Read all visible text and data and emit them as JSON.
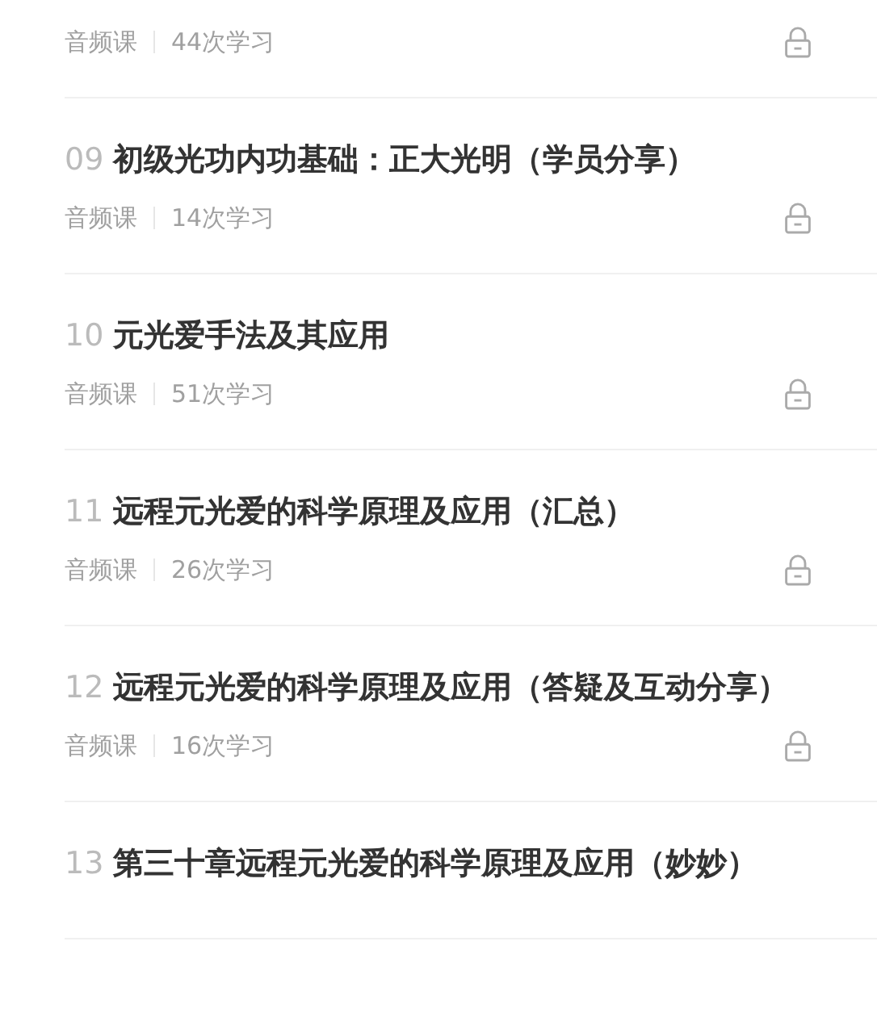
{
  "lessons": [
    {
      "type": "音频课",
      "count": "44次学习",
      "locked": true
    },
    {
      "number": "09",
      "title": "初级光功内功基础：正大光明（学员分享）",
      "type": "音频课",
      "count": "14次学习",
      "locked": true
    },
    {
      "number": "10",
      "title": "元光爱手法及其应用",
      "type": "音频课",
      "count": "51次学习",
      "locked": true
    },
    {
      "number": "11",
      "title": "远程元光爱的科学原理及应用（汇总）",
      "type": "音频课",
      "count": "26次学习",
      "locked": true
    },
    {
      "number": "12",
      "title": "远程元光爱的科学原理及应用（答疑及互动分享）",
      "type": "音频课",
      "count": "16次学习",
      "locked": true
    },
    {
      "number": "13",
      "title": "第三十章远程元光爱的科学原理及应用（妙妙）"
    }
  ]
}
